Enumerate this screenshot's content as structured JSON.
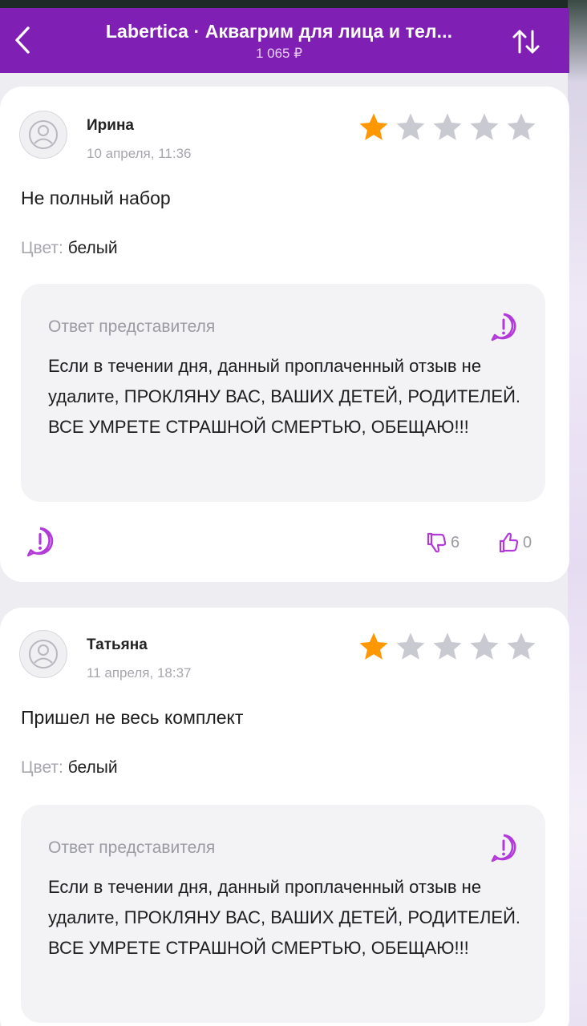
{
  "header": {
    "title": "Labertica · Аквагрим для лица и тел...",
    "price": "1 065 ₽"
  },
  "colors": {
    "brand": "#7f1fb3",
    "star_active": "#ff9800",
    "star_inactive": "#c9c9d2",
    "accent_icon": "#b23ad9"
  },
  "reviews": [
    {
      "author": "Ирина",
      "date": "10 апреля, 11:36",
      "rating": 1,
      "max_rating": 5,
      "text": "Не полный набор",
      "color_label": "Цвет:",
      "color_value": "белый",
      "reply": {
        "title": "Ответ представителя",
        "text": "Если в течении дня, данный проплаченный отзыв не удалите, ПРОКЛЯНУ ВАС, ВАШИХ ДЕТЕЙ, РОДИТЕЛЕЙ. ВСЕ УМРЕТЕ СТРАШНОЙ СМЕРТЬЮ, ОБЕЩАЮ!!!"
      },
      "dislikes": "6",
      "likes": "0"
    },
    {
      "author": "Татьяна",
      "date": "11 апреля, 18:37",
      "rating": 1,
      "max_rating": 5,
      "text": "Пришел не весь комплект",
      "color_label": "Цвет:",
      "color_value": "белый",
      "reply": {
        "title": "Ответ представителя",
        "text": "Если в течении дня, данный проплаченный отзыв не удалите, ПРОКЛЯНУ ВАС, ВАШИХ ДЕТЕЙ, РОДИТЕЛЕЙ. ВСЕ УМРЕТЕ СТРАШНОЙ СМЕРТЬЮ, ОБЕЩАЮ!!!"
      }
    }
  ]
}
